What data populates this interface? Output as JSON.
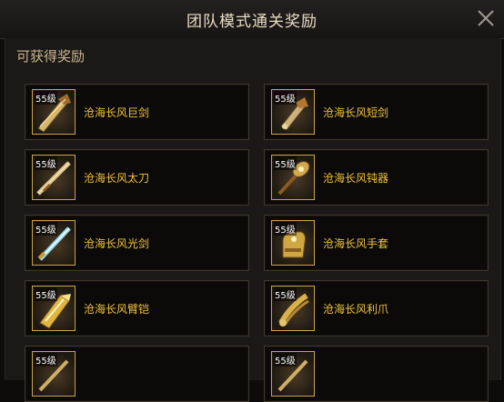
{
  "dialog": {
    "title": "团队模式通关奖励"
  },
  "section": {
    "title": "可获得奖励"
  },
  "items": [
    {
      "level": "55级",
      "name": "沧海长风巨剑",
      "icon": "greatsword-icon"
    },
    {
      "level": "55级",
      "name": "沧海长风短剑",
      "icon": "shortsword-icon"
    },
    {
      "level": "55级",
      "name": "沧海长风太刀",
      "icon": "katana-icon"
    },
    {
      "level": "55级",
      "name": "沧海长风钝器",
      "icon": "blunt-weapon-icon"
    },
    {
      "level": "55级",
      "name": "沧海长风光剑",
      "icon": "lightsaber-icon"
    },
    {
      "level": "55级",
      "name": "沧海长风手套",
      "icon": "gauntlet-icon"
    },
    {
      "level": "55级",
      "name": "沧海长风臂铠",
      "icon": "arm-guard-icon"
    },
    {
      "level": "55级",
      "name": "沧海长风利爪",
      "icon": "claw-icon"
    },
    {
      "level": "55级",
      "name": "",
      "icon": "weapon-icon"
    },
    {
      "level": "55级",
      "name": "",
      "icon": "weapon-icon"
    }
  ],
  "colors": {
    "accent_gold": "#f0c23a",
    "border_gold": "#c9a44a",
    "title": "#e9dcc3"
  }
}
